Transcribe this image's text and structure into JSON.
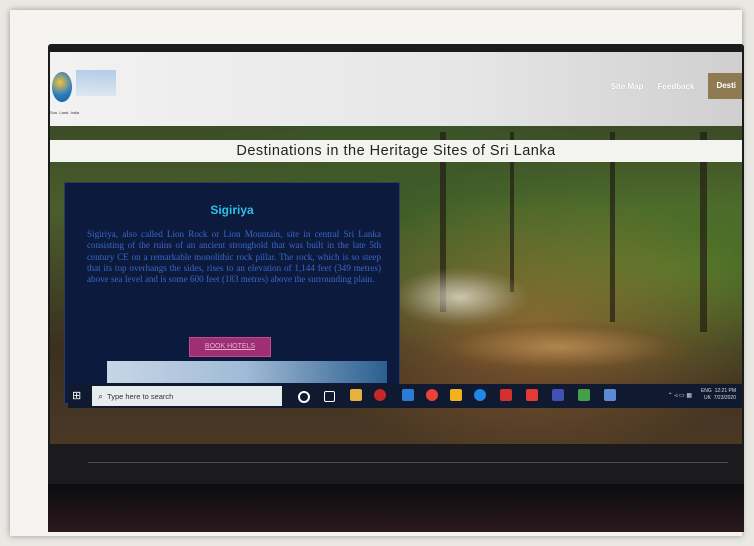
{
  "site": {
    "tagline": "Sun. Land. India",
    "nav": {
      "links": [
        "Site Map",
        "Feedback"
      ],
      "active": "Desti"
    },
    "page_title": "Destinations in the Heritage Sites of Sri Lanka",
    "card": {
      "title": "Sigiriya",
      "description": "Sigiriya, also called Lion Rock or Lion Mountain, site in central Sri Lanka consisting of the ruins of an ancient stronghold that was built in the late 5th century CE on a remarkable monolithic rock pillar. The rock, which is so steep that its top overhangs the sides, rises to an elevation of 1,144 feet (349 metres) above sea level and is some 600 feet (183 metres) above the surrounding plain.",
      "button": "BOOK HOTELS"
    }
  },
  "taskbar": {
    "search_placeholder": "Type here to search",
    "lang_top": "ENG",
    "lang_bottom": "UK",
    "time": "12:21 PM",
    "date": "7/23/2020",
    "icon_colors": [
      "#ffffff",
      "#ffffff",
      "#e8b13d",
      "#c62828",
      "#2d7bd6",
      "#ea4335",
      "#f2b21b",
      "#1e88e5",
      "#d32f2f",
      "#e53935",
      "#3f51b5",
      "#43a047",
      "#5c8bd6"
    ]
  }
}
